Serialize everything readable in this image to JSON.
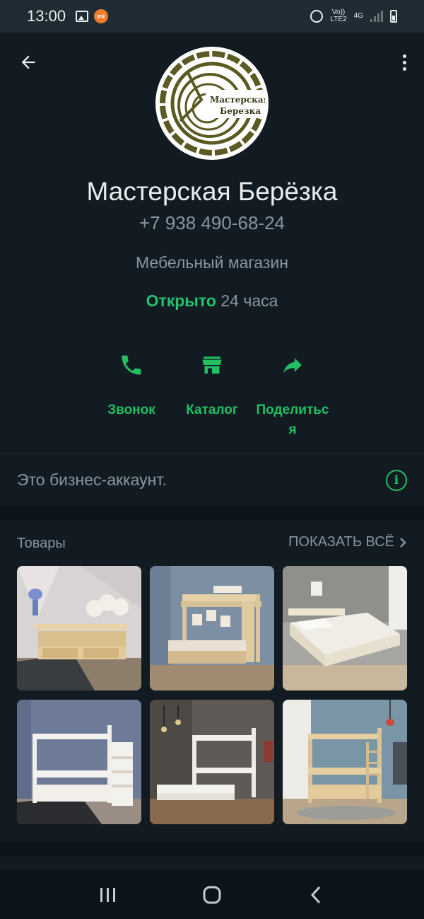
{
  "status_bar": {
    "time": "13:00",
    "network_top": "Vo))",
    "network_bottom": "LTE2",
    "network_type": "4G"
  },
  "profile": {
    "logo_text_line1": "Мастерская",
    "logo_text_line2": "Березка",
    "name": "Мастерская Берёзка",
    "phone": "+7 938 490-68-24",
    "category": "Мебельный магазин",
    "hours_open": "Открыто",
    "hours_rest": " 24 часа"
  },
  "actions": [
    {
      "label": "Звонок",
      "icon": "phone-icon"
    },
    {
      "label": "Каталог",
      "icon": "storefront-icon"
    },
    {
      "label_line1": "Поделитьс",
      "label_line2": "я",
      "icon": "share-icon"
    }
  ],
  "info": {
    "business_text": "Это бизнес-аккаунт."
  },
  "products": {
    "title": "Товары",
    "show_all": "ПОКАЗАТЬ ВСЁ",
    "items": [
      {
        "name": "kids-bed-with-drawers"
      },
      {
        "name": "loft-bed-with-bed-below"
      },
      {
        "name": "double-bed"
      },
      {
        "name": "bunk-bed-with-stairs"
      },
      {
        "name": "bunk-bed-with-trundle"
      },
      {
        "name": "bunk-bed-with-ladder"
      }
    ]
  },
  "colors": {
    "accent": "#21c063",
    "background": "#121b22",
    "secondary_text": "#8696a0"
  }
}
